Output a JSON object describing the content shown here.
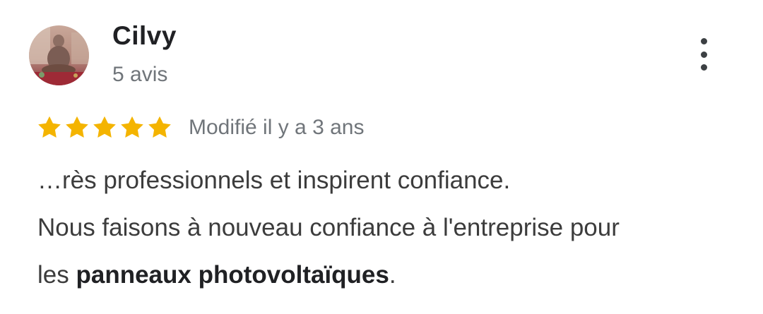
{
  "review": {
    "reviewer_name": "Cilvy",
    "review_count": "5 avis",
    "rating": 5,
    "rating_max": 5,
    "star_color": "#f4b400",
    "edited_date": "Modifié il y a 3 ans",
    "text_line1": "…rès professionnels et inspirent confiance.",
    "text_line2": "Nous faisons à nouveau confiance à l'entreprise pour",
    "text_line3_prefix": "les ",
    "text_line3_highlight": "panneaux photovoltaïques",
    "text_line3_suffix": "."
  },
  "icons": {
    "more": "more-vert-icon",
    "star": "star-icon",
    "avatar": "avatar-photo"
  }
}
